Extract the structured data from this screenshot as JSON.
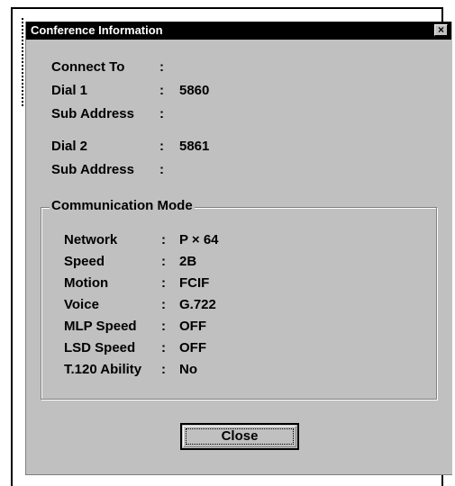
{
  "window": {
    "title": "Conference Information",
    "close_glyph": "×"
  },
  "connection": {
    "connect_to": {
      "label": "Connect To",
      "value": ""
    },
    "dial1": {
      "label": "Dial 1",
      "value": "5860"
    },
    "sub_address1": {
      "label": "Sub Address",
      "value": ""
    },
    "dial2": {
      "label": "Dial 2",
      "value": "5861"
    },
    "sub_address2": {
      "label": "Sub Address",
      "value": ""
    }
  },
  "communication_mode": {
    "title": "Communication Mode",
    "items": [
      {
        "label": "Network",
        "value": "P × 64"
      },
      {
        "label": "Speed",
        "value": "2B"
      },
      {
        "label": "Motion",
        "value": "FCIF"
      },
      {
        "label": "Voice",
        "value": "G.722"
      },
      {
        "label": "MLP Speed",
        "value": "OFF"
      },
      {
        "label": "LSD Speed",
        "value": "OFF"
      },
      {
        "label": "T.120 Ability",
        "value": "No"
      }
    ]
  },
  "buttons": {
    "close_label": "Close"
  },
  "colors": {
    "dialog_bg": "#c0c0c0",
    "titlebar_bg": "#000000",
    "title_text": "#ffffff"
  }
}
